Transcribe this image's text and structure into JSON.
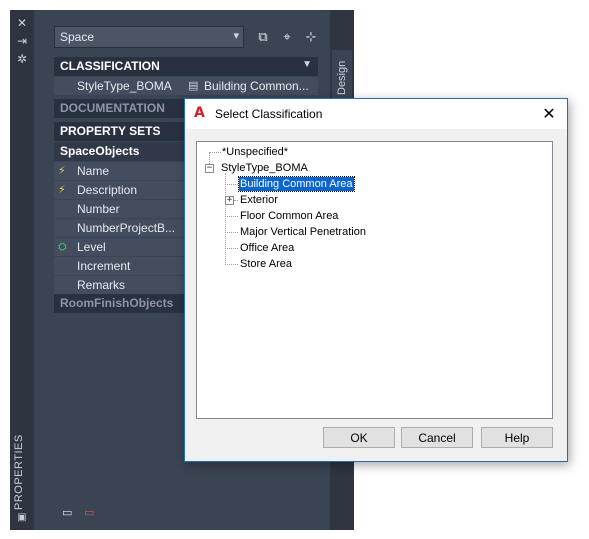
{
  "palette": {
    "title": "PROPERTIES",
    "strip_buttons": [
      "close-icon",
      "auto-hide-icon",
      "settings-icon"
    ],
    "design_tab": "Design",
    "object_select": {
      "value": "Space"
    },
    "toolbar_icons": [
      "add-style-icon",
      "select-objects-icon",
      "quick-select-icon"
    ],
    "categories": {
      "classification": "CLASSIFICATION",
      "documentation": "DOCUMENTATION",
      "property_sets": "PROPERTY SETS",
      "space_objects": "SpaceObjects",
      "room_finish_objects": "RoomFinishObjects"
    },
    "classification_row": {
      "name": "StyleType_BOMA",
      "value": "Building  Common..."
    },
    "properties": [
      {
        "name": "Name",
        "icon": "automatic-icon"
      },
      {
        "name": "Description",
        "icon": "automatic-icon"
      },
      {
        "name": "Number",
        "icon": ""
      },
      {
        "name": "NumberProjectB...",
        "icon": ""
      },
      {
        "name": "Level",
        "icon": "level-icon"
      },
      {
        "name": "Increment",
        "icon": ""
      },
      {
        "name": "Remarks",
        "icon": ""
      }
    ],
    "bottom_icons": [
      "add-property-set-icon",
      "remove-property-set-icon"
    ]
  },
  "dialog": {
    "title": "Select Classification",
    "tree": {
      "unspecified": "*Unspecified*",
      "root": "StyleType_BOMA",
      "children": [
        {
          "label": "Building Common Area",
          "selected": true,
          "expandable": false
        },
        {
          "label": "Exterior",
          "selected": false,
          "expandable": true
        },
        {
          "label": "Floor Common Area",
          "selected": false,
          "expandable": false
        },
        {
          "label": "Major Vertical Penetration",
          "selected": false,
          "expandable": false
        },
        {
          "label": "Office Area",
          "selected": false,
          "expandable": false
        },
        {
          "label": "Store Area",
          "selected": false,
          "expandable": false
        }
      ]
    },
    "buttons": {
      "ok": "OK",
      "cancel": "Cancel",
      "help": "Help"
    }
  },
  "colors": {
    "palette_bg": "#3b4453",
    "header_bg": "#293040",
    "selection": "#0a64d2",
    "dialog_border": "#1e6fb5"
  }
}
